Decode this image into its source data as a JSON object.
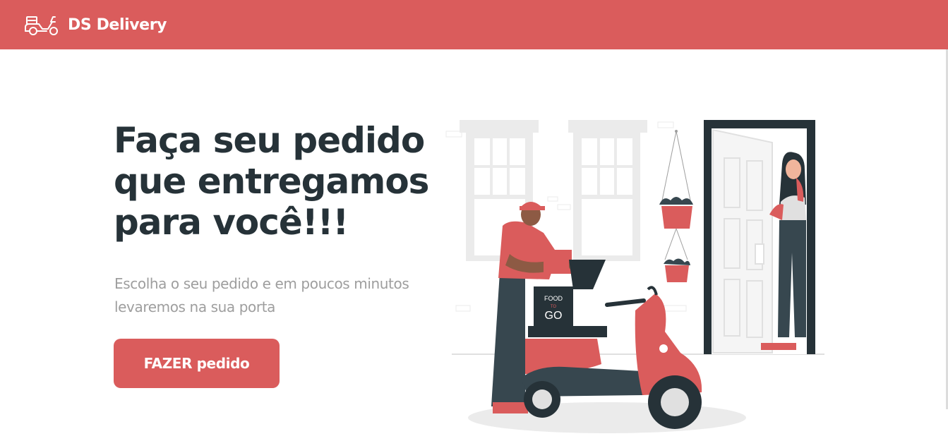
{
  "header": {
    "brand_name": "DS Delivery",
    "logo_icon": "delivery-scooter-icon"
  },
  "hero": {
    "title": "Faça seu pedido\nque entregamos\npara você!!!",
    "subtitle": "Escolha o seu pedido e em poucos minutos levaremos na sua porta",
    "button_label": "FAZER pedido",
    "illustration_box_text": [
      "FOOD",
      "TO",
      "GO"
    ]
  },
  "colors": {
    "primary": "#DA5C5C",
    "title_text": "#263238",
    "subtitle_text": "#9E9E9E",
    "background": "#FFFFFF"
  }
}
